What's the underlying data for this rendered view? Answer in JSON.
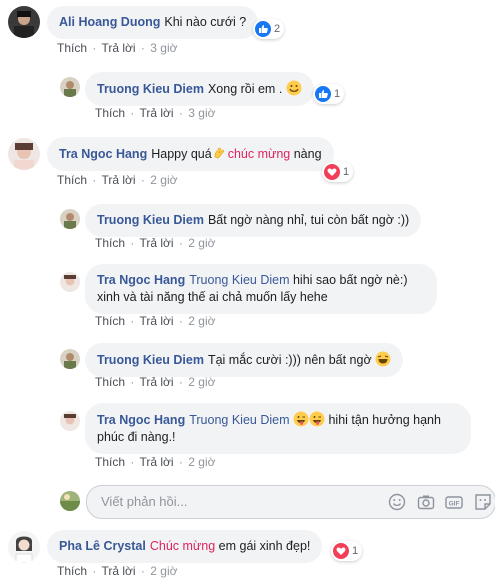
{
  "actions": {
    "like": "Thích",
    "reply": "Trả lời",
    "sep": "·"
  },
  "comments": [
    {
      "name": "Ali Hoang Duong",
      "text": "Khi nào cưới ?",
      "time": "3 giờ",
      "react": {
        "type": "like",
        "count": "2"
      }
    },
    {
      "name": "Truong Kieu Diem",
      "text": "Xong rồi em .",
      "time": "3 giờ",
      "react": {
        "type": "like",
        "count": "1"
      }
    },
    {
      "name": "Tra Ngoc Hang",
      "text1": "Happy quá",
      "highlight": "chúc mừng",
      "text2": " nàng",
      "time": "2 giờ",
      "react": {
        "type": "heart",
        "count": "1"
      }
    },
    {
      "name": "Truong Kieu Diem",
      "text": "Bất ngờ nàng nhỉ, tui còn bất ngờ :))",
      "time": "2 giờ"
    },
    {
      "name": "Tra Ngoc Hang",
      "tag": "Truong Kieu Diem",
      "text": "hihi sao bất ngờ nè:) xinh và tài năng thế ai chả muốn lấy hehe",
      "time": "2 giờ"
    },
    {
      "name": "Truong Kieu Diem",
      "text": "Tại mắc cười :))) nên bất ngờ",
      "time": "2 giờ"
    },
    {
      "name": "Tra Ngoc Hang",
      "tag": "Truong Kieu Diem",
      "text": "hihi tận hưởng hạnh phúc đi nàng.!",
      "time": "2 giờ"
    },
    {
      "name": "Pha Lê Crystal",
      "highlight": "Chúc mừng",
      "text": " em gái xinh đẹp!",
      "time": "2 giờ",
      "react": {
        "type": "heart",
        "count": "1"
      }
    }
  ],
  "reply_box": {
    "placeholder": "Viết phản hồi..."
  },
  "icons": {
    "like": "like-icon",
    "heart": "heart-icon",
    "smile": "smile-emoji-icon",
    "laugh": "laugh-emoji-icon",
    "wink": "wink-tongue-emoji-icon",
    "clap": "clapping-hands-emoji-icon",
    "emoji_btn": "emoji-button-icon",
    "camera": "camera-icon",
    "gif": "gif-icon",
    "sticker": "sticker-icon"
  },
  "colors": {
    "link": "#385898",
    "highlight": "#e0245e",
    "bubble": "#f2f3f5",
    "like": "#1877f2",
    "heart": "#f33e58"
  }
}
